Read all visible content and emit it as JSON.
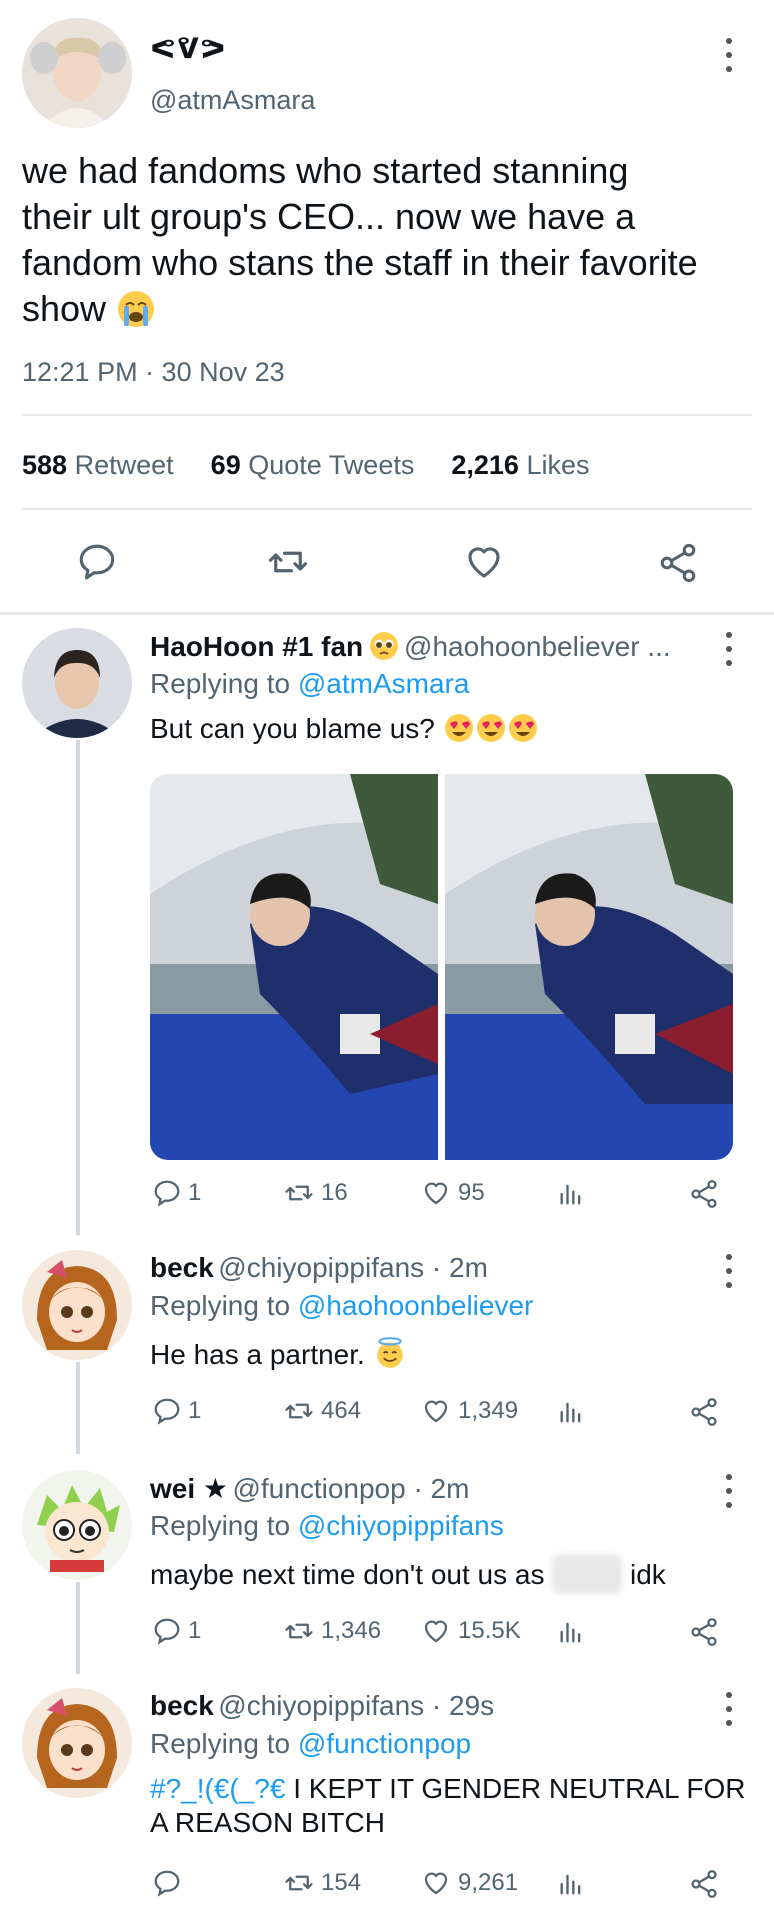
{
  "main_tweet": {
    "display_name": "ᕙᕓᕗ",
    "handle": "@atmAsmara",
    "text_lines": [
      "we had fandoms who started stanning",
      "their ult group's CEO... now we have a",
      "fandom who stans the staff in their favorite",
      "show"
    ],
    "timestamp": "12:21 PM · 30 Nov 23",
    "stats": {
      "retweets_count": "588",
      "retweets_label": "Retweet",
      "quotes_count": "69",
      "quotes_label": "Quote Tweets",
      "likes_count": "2,216",
      "likes_label": "Likes"
    }
  },
  "replies": [
    {
      "display_name": "HaoHoon #1 fan",
      "handle": "@haohoonbeliever ...",
      "replying_prefix": "Replying to",
      "replying_to": "@atmAsmara",
      "text": "But can you blame us?",
      "actions": {
        "reply": "1",
        "retweet": "16",
        "like": "95"
      }
    },
    {
      "display_name": "beck",
      "handle": "@chiyopippifans · 2m",
      "replying_prefix": "Replying to",
      "replying_to": "@haohoonbeliever",
      "text": "He has a partner.",
      "actions": {
        "reply": "1",
        "retweet": "464",
        "like": "1,349"
      }
    },
    {
      "display_name": "wei ★",
      "handle": "@functionpop · 2m",
      "replying_prefix": "Replying to",
      "replying_to": "@chiyopippifans",
      "text": "maybe next time don't out us as",
      "text_after": "idk",
      "actions": {
        "reply": "1",
        "retweet": "1,346",
        "like": "15.5K"
      }
    },
    {
      "display_name": "beck",
      "handle": "@chiyopippifans · 29s",
      "replying_prefix": "Replying to",
      "replying_to": "@functionpop",
      "text_tag": "#?_!(€(_?€",
      "text_line1": " I KEPT IT GENDER NEUTRAL FOR",
      "text_line2": "A REASON BITCH",
      "actions": {
        "reply": "",
        "retweet": "154",
        "like": "9,261"
      }
    }
  ],
  "colors": {
    "accent": "#1d9bf0",
    "muted": "#536471",
    "text": "#0f1419",
    "divider": "#e5e8eb"
  }
}
